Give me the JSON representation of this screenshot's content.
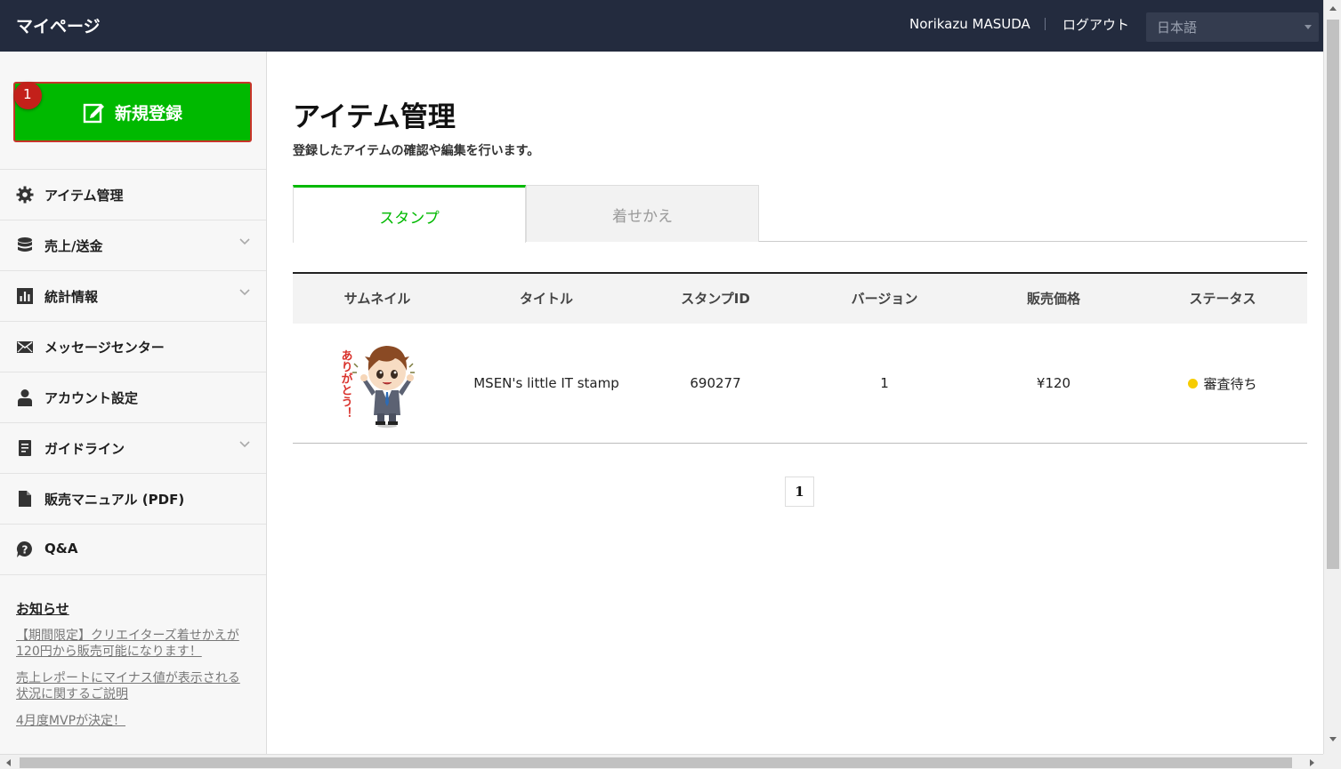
{
  "header": {
    "brand": "マイページ",
    "user_name": "Norikazu MASUDA",
    "logout": "ログアウト",
    "language": "日本語"
  },
  "sidebar": {
    "register_button": "新規登録",
    "step_badge": "1",
    "items": [
      {
        "label": "アイテム管理",
        "icon": "gear-icon",
        "expandable": false
      },
      {
        "label": "売上/送金",
        "icon": "database-icon",
        "expandable": true
      },
      {
        "label": "統計情報",
        "icon": "bar-chart-icon",
        "expandable": true
      },
      {
        "label": "メッセージセンター",
        "icon": "envelope-icon",
        "expandable": false
      },
      {
        "label": "アカウント設定",
        "icon": "person-icon",
        "expandable": false
      },
      {
        "label": "ガイドライン",
        "icon": "document-icon",
        "expandable": true
      },
      {
        "label": "販売マニュアル (PDF)",
        "icon": "file-icon",
        "expandable": false
      },
      {
        "label": "Q&A",
        "icon": "question-icon",
        "expandable": false
      }
    ],
    "notices_heading": "お知らせ",
    "notices": [
      "【期間限定】クリエイターズ着せかえが120円から販売可能になります！",
      "売上レポートにマイナス値が表示される状況に関するご説明",
      "4月度MVPが決定！"
    ]
  },
  "main": {
    "title": "アイテム管理",
    "subtitle": "登録したアイテムの確認や編集を行います。",
    "tabs": [
      {
        "label": "スタンプ",
        "active": true
      },
      {
        "label": "着せかえ",
        "active": false
      }
    ],
    "table": {
      "columns": [
        "サムネイル",
        "タイトル",
        "スタンプID",
        "バージョン",
        "販売価格",
        "ステータス"
      ],
      "rows": [
        {
          "thumbnail_text": "ありがとう！",
          "title": "MSEN's little IT stamp",
          "stamp_id": "690277",
          "version": "1",
          "price": "¥120",
          "status": "審査待ち",
          "status_color": "#f6cc00"
        }
      ]
    },
    "pagination": {
      "current": "1"
    }
  },
  "colors": {
    "header_bg": "#232b3e",
    "accent_green": "#00b900",
    "badge_red": "#c3201a"
  }
}
